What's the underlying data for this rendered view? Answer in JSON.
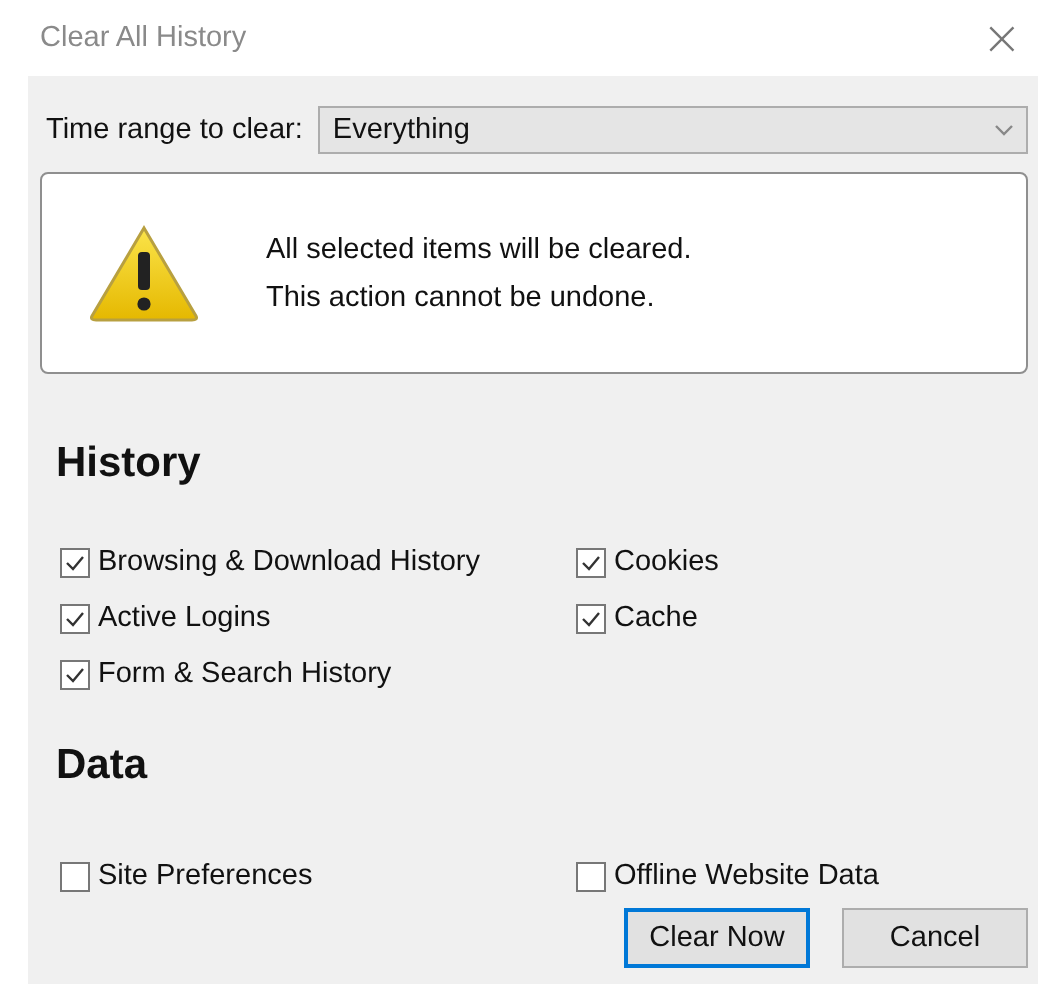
{
  "window": {
    "title": "Clear All History",
    "close": "×"
  },
  "time_range": {
    "label": "Time range to clear:",
    "value": "Everything"
  },
  "warning": {
    "lines": [
      "All selected items will be cleared.",
      "This action cannot be undone."
    ]
  },
  "sections": [
    {
      "heading": "History",
      "items": [
        {
          "label": "Browsing & Download History",
          "checked": true
        },
        {
          "label": "Cookies",
          "checked": true
        },
        {
          "label": "Active Logins",
          "checked": true
        },
        {
          "label": "Cache",
          "checked": true
        },
        {
          "label": "Form & Search History",
          "checked": true
        }
      ]
    },
    {
      "heading": "Data",
      "items": [
        {
          "label": "Site Preferences",
          "checked": false
        },
        {
          "label": "Offline Website Data",
          "checked": false
        }
      ]
    }
  ],
  "buttons": [
    {
      "label": "Clear Now",
      "default": true
    },
    {
      "label": "Cancel",
      "default": false
    }
  ]
}
